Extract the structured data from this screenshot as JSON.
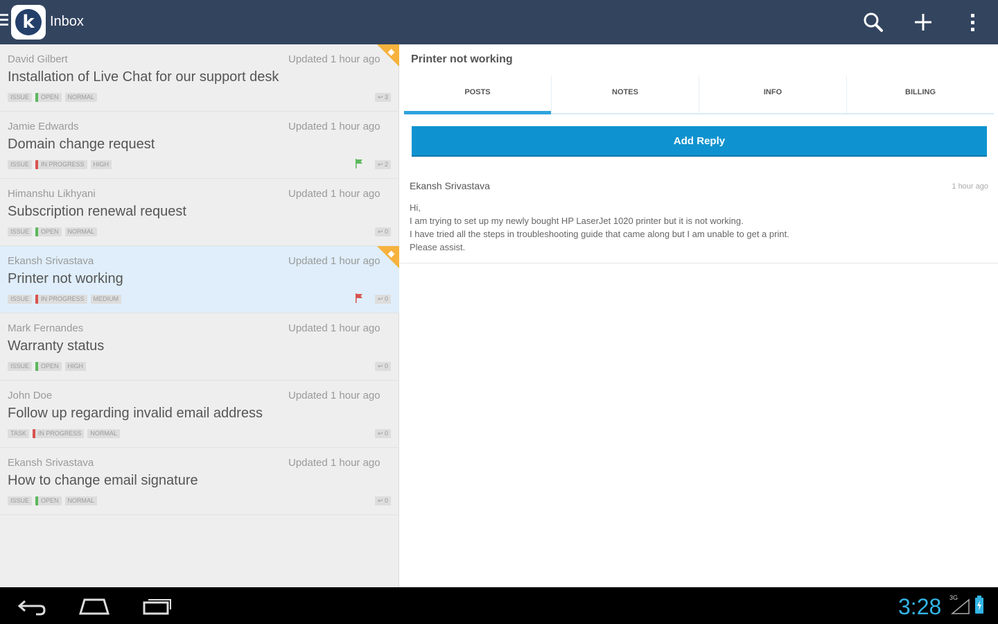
{
  "app": {
    "title": "Inbox",
    "logo_letter": "k"
  },
  "toolbar": {
    "icons": [
      "search-icon",
      "add-icon",
      "overflow-menu-icon"
    ]
  },
  "colors": {
    "action_bar": "#33445f",
    "accent": "#0e93d0",
    "status_open": "#5cb85c",
    "status_in_progress": "#d9534f",
    "highlight_corner": "#f6b23d"
  },
  "tickets": [
    {
      "name": "David Gilbert",
      "updated": "Updated 1 hour ago",
      "subject": "Installation of Live Chat for our support desk",
      "type": "ISSUE",
      "status": "OPEN",
      "priority": "NORMAL",
      "count": "3",
      "flagged": false,
      "starred": true,
      "selected": false
    },
    {
      "name": "Jamie Edwards",
      "updated": "Updated 1 hour ago",
      "subject": "Domain change request",
      "type": "ISSUE",
      "status": "IN PROGRESS",
      "priority": "HIGH",
      "count": "2",
      "flagged": true,
      "flag_color": "#5cb85c",
      "starred": false,
      "selected": false
    },
    {
      "name": "Himanshu Likhyani",
      "updated": "Updated 1 hour ago",
      "subject": "Subscription renewal request",
      "type": "ISSUE",
      "status": "OPEN",
      "priority": "NORMAL",
      "count": "0",
      "flagged": false,
      "starred": false,
      "selected": false
    },
    {
      "name": "Ekansh Srivastava",
      "updated": "Updated 1 hour ago",
      "subject": "Printer not working",
      "type": "ISSUE",
      "status": "IN PROGRESS",
      "priority": "MEDIUM",
      "count": "0",
      "flagged": true,
      "flag_color": "#d9534f",
      "starred": true,
      "selected": true
    },
    {
      "name": "Mark Fernandes",
      "updated": "Updated 1 hour ago",
      "subject": "Warranty status",
      "type": "ISSUE",
      "status": "OPEN",
      "priority": "HIGH",
      "count": "0",
      "flagged": false,
      "starred": false,
      "selected": false
    },
    {
      "name": "John Doe",
      "updated": "Updated 1 hour ago",
      "subject": "Follow up regarding invalid email address",
      "type": "TASK",
      "status": "IN PROGRESS",
      "priority": "NORMAL",
      "count": "0",
      "flagged": false,
      "starred": false,
      "selected": false
    },
    {
      "name": "Ekansh Srivastava",
      "updated": "Updated 1 hour ago",
      "subject": "How to change email signature",
      "type": "ISSUE",
      "status": "OPEN",
      "priority": "NORMAL",
      "count": "0",
      "flagged": false,
      "starred": false,
      "selected": false
    }
  ],
  "detail": {
    "title": "Printer not working",
    "tabs": [
      {
        "label": "POSTS",
        "active": true
      },
      {
        "label": "NOTES",
        "active": false
      },
      {
        "label": "INFO",
        "active": false
      },
      {
        "label": "BILLING",
        "active": false
      }
    ],
    "add_reply_label": "Add Reply",
    "post": {
      "author": "Ekansh Srivastava",
      "time": "1 hour ago",
      "lines": [
        "Hi,",
        "I am trying to set up my newly bought HP LaserJet 1020 printer but it is not working.",
        "I have tried all the steps in troubleshooting guide that came along but I am unable to get a print.",
        "Please assist."
      ]
    }
  },
  "system_bar": {
    "clock": "3:28",
    "signal_label": "3G",
    "buttons": [
      "back-icon",
      "home-icon",
      "recent-apps-icon"
    ]
  }
}
